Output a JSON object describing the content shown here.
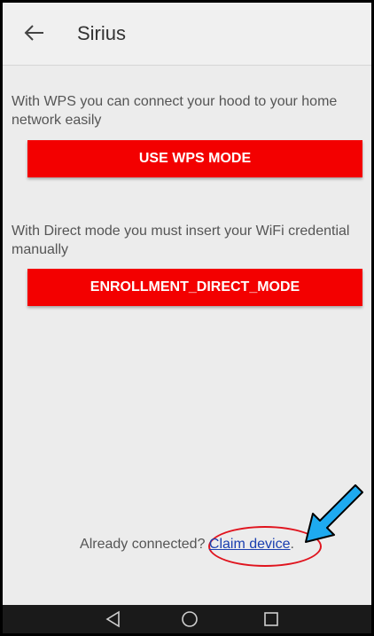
{
  "header": {
    "title": "Sirius",
    "back_icon": "arrow-left-icon"
  },
  "wps": {
    "description": "With WPS you can connect your hood to your home network easily",
    "button_label": "USE WPS MODE"
  },
  "direct": {
    "description": "With Direct mode you must insert your WiFi credential manually",
    "button_label": "ENROLLMENT_DIRECT_MODE"
  },
  "footer": {
    "prefix": "Already connected?",
    "link_label": "Claim device",
    "suffix": "."
  },
  "navbar": {
    "icons": [
      "back-triangle-icon",
      "home-circle-icon",
      "recents-square-icon"
    ]
  },
  "colors": {
    "accent": "#f30000",
    "link": "#1a3fb0",
    "annotation_oval": "#e0141e",
    "annotation_arrow": "#1eaaf0"
  }
}
